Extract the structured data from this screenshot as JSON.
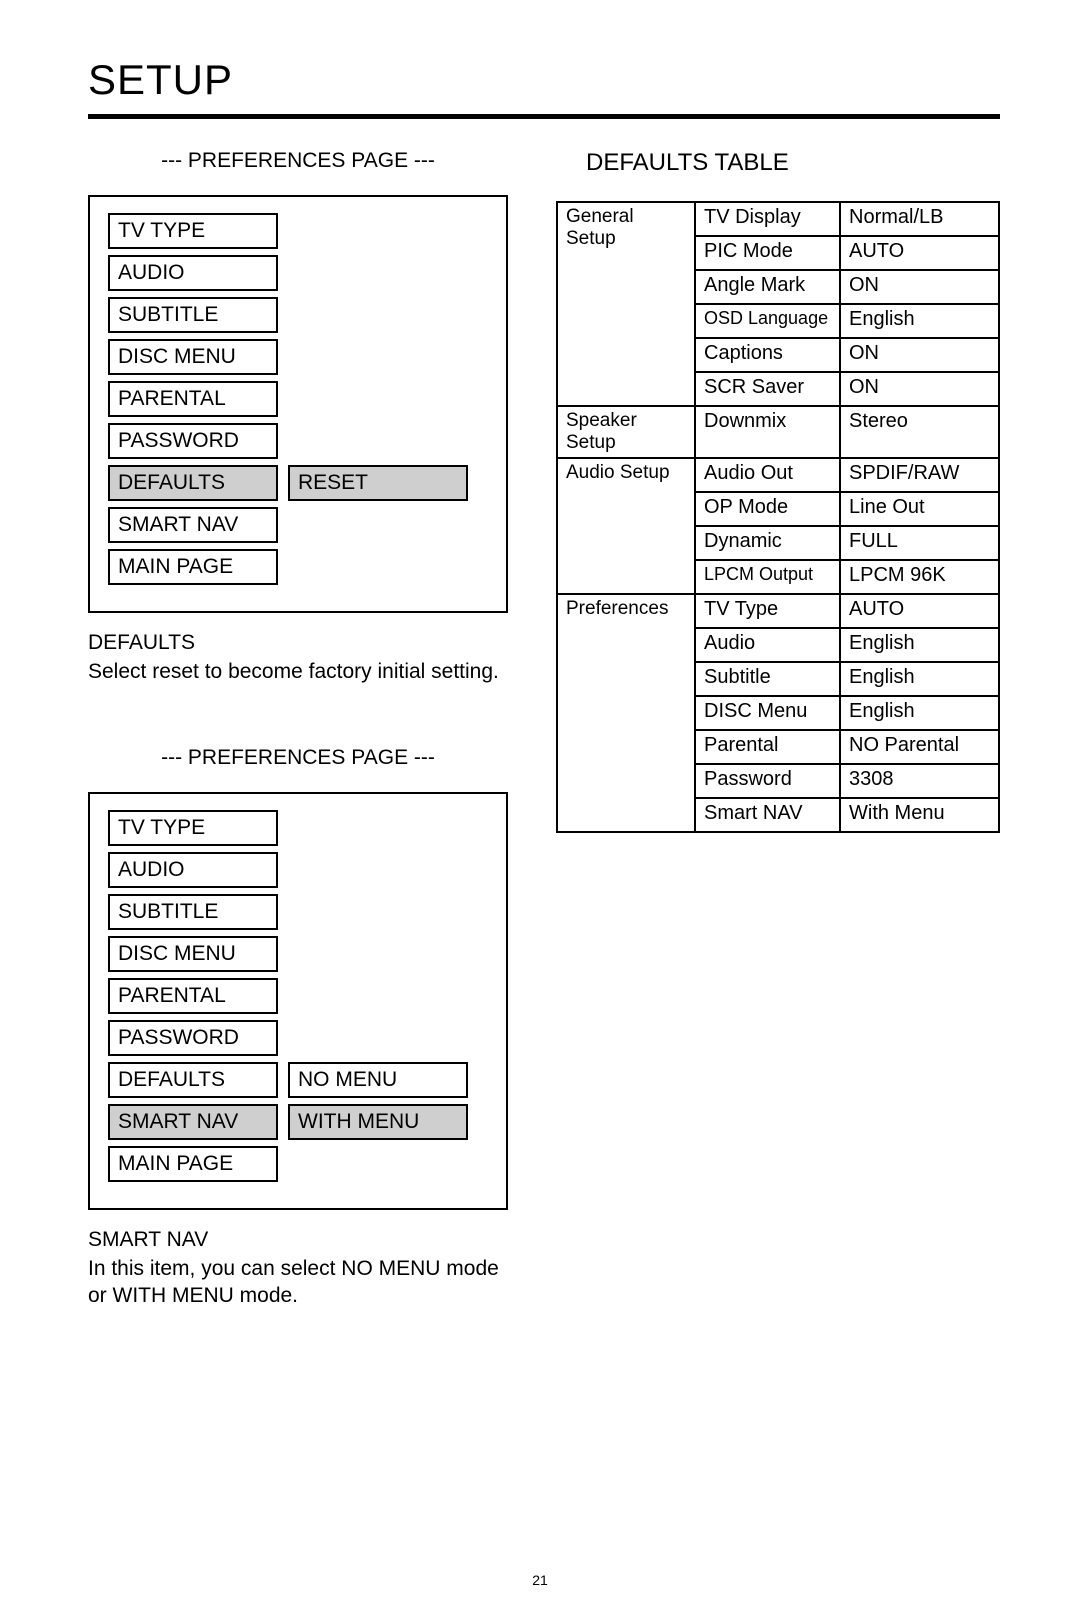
{
  "pageTitle": "SETUP",
  "pageNumber": "21",
  "pref1": {
    "heading": "--- PREFERENCES PAGE ---",
    "items": [
      {
        "label": "TV TYPE"
      },
      {
        "label": "AUDIO"
      },
      {
        "label": "SUBTITLE"
      },
      {
        "label": "DISC MENU"
      },
      {
        "label": "PARENTAL"
      },
      {
        "label": "PASSWORD"
      },
      {
        "label": "DEFAULTS",
        "highlight": true,
        "sub": "RESET",
        "subHighlight": true
      },
      {
        "label": "SMART NAV"
      },
      {
        "label": "MAIN PAGE"
      }
    ],
    "captionHead": "DEFAULTS",
    "captionBody": "Select reset to become factory initial setting."
  },
  "pref2": {
    "heading": "--- PREFERENCES PAGE ---",
    "items": [
      {
        "label": "TV TYPE"
      },
      {
        "label": "AUDIO"
      },
      {
        "label": "SUBTITLE"
      },
      {
        "label": "DISC MENU"
      },
      {
        "label": "PARENTAL"
      },
      {
        "label": "PASSWORD"
      },
      {
        "label": "DEFAULTS",
        "sub": "NO MENU"
      },
      {
        "label": "SMART NAV",
        "highlight": true,
        "sub": "WITH MENU",
        "subHighlight": true
      },
      {
        "label": "MAIN PAGE"
      }
    ],
    "captionHead": "SMART NAV",
    "captionBody": "In this item, you can select NO MENU mode or WITH MENU mode."
  },
  "defaultsTableTitle": "DEFAULTS TABLE",
  "defaultsTable": [
    {
      "cat": "General Setup",
      "rows": [
        {
          "setting": "TV Display",
          "value": "Normal/LB"
        },
        {
          "setting": "PIC Mode",
          "value": "AUTO"
        },
        {
          "setting": "Angle Mark",
          "value": "ON"
        },
        {
          "setting": "OSD Language",
          "value": "English",
          "small": true
        },
        {
          "setting": "Captions",
          "value": "ON"
        },
        {
          "setting": "SCR Saver",
          "value": "ON"
        }
      ]
    },
    {
      "cat": "Speaker Setup",
      "small": true,
      "rows": [
        {
          "setting": "Downmix",
          "value": "Stereo"
        }
      ]
    },
    {
      "cat": "Audio Setup",
      "rows": [
        {
          "setting": "Audio Out",
          "value": "SPDIF/RAW"
        },
        {
          "setting": "OP Mode",
          "value": "Line Out"
        },
        {
          "setting": "Dynamic",
          "value": "FULL"
        },
        {
          "setting": "LPCM Output",
          "value": "LPCM 96K",
          "small": true
        }
      ]
    },
    {
      "cat": "Preferences",
      "rows": [
        {
          "setting": "TV Type",
          "value": "AUTO"
        },
        {
          "setting": "Audio",
          "value": "English"
        },
        {
          "setting": "Subtitle",
          "value": "English"
        },
        {
          "setting": "DISC Menu",
          "value": "English"
        },
        {
          "setting": "Parental",
          "value": "NO Parental"
        },
        {
          "setting": "Password",
          "value": "3308"
        },
        {
          "setting": "Smart NAV",
          "value": "With Menu"
        }
      ]
    }
  ]
}
